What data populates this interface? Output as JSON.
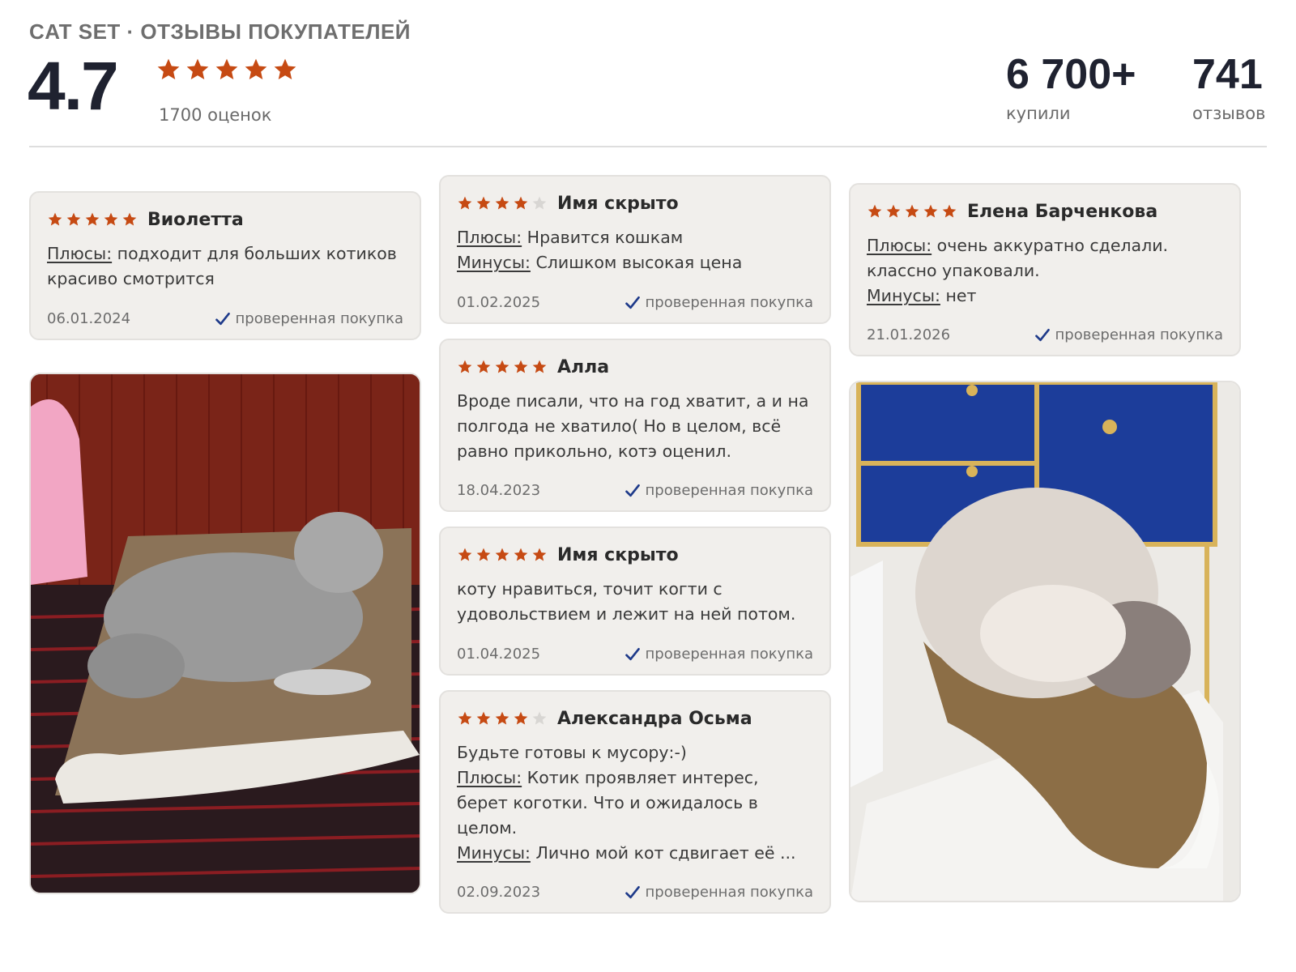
{
  "header": {
    "label": "CAT SET · ОТЗЫВЫ ПОКУПАТЕЛЕЙ",
    "rating": "4.7",
    "rating_stars": 5,
    "ratings_count": "1700 оценок",
    "bought_value": "6 700+",
    "bought_label": "купили",
    "reviews_value": "741",
    "reviews_label": "отзывов"
  },
  "colors": {
    "star_filled": "#c64a13",
    "star_empty": "#d8d6d3",
    "check": "#1e3a8a",
    "card_bg": "#f1efec"
  },
  "verified_label": "проверенная покупка",
  "reviews": [
    {
      "stars": 5,
      "author": "Виолетта",
      "lines": [
        {
          "key": "Плюсы:",
          "text": "подходит для больших котиков красиво смотрится"
        }
      ],
      "date": "06.01.2024"
    },
    {
      "stars": 4,
      "author": "Имя скрыто",
      "lines": [
        {
          "key": "Плюсы:",
          "text": "Нравится кошкам"
        },
        {
          "key": "Минусы:",
          "text": "Слишком высокая цена"
        }
      ],
      "date": "01.02.2025"
    },
    {
      "stars": 5,
      "author": "Алла",
      "lines": [
        {
          "key": "",
          "text": "Вроде писали, что на год хватит, а и на полгода не хватило( Но в целом, всё равно прикольно, котэ оценил."
        }
      ],
      "date": "18.04.2023"
    },
    {
      "stars": 5,
      "author": "Имя скрыто",
      "lines": [
        {
          "key": "",
          "text": "коту нравиться, точит когти с удовольствием и лежит на ней потом."
        }
      ],
      "date": "01.04.2025"
    },
    {
      "stars": 4,
      "author": "Александра Осьма",
      "lines": [
        {
          "key": "",
          "text": "Будьте готовы к мусору:-)"
        },
        {
          "key": "Плюсы:",
          "text": "Котик проявляет интерес, берет коготки. Что и ожидалось в целом."
        },
        {
          "key": "Минусы:",
          "text": "Лично мой кот сдвигает её ..."
        }
      ],
      "date": "02.09.2023"
    },
    {
      "stars": 5,
      "author": "Елена Барченкова",
      "lines": [
        {
          "key": "Плюсы:",
          "text": "очень аккуратно сделали. классно упаковали."
        },
        {
          "key": "Минусы:",
          "text": "нет"
        }
      ],
      "date": "21.01.2026"
    }
  ],
  "photos": [
    {
      "icon": "tabby-cat-on-scratcher-photo"
    },
    {
      "icon": "fluffy-cat-on-scratcher-photo"
    }
  ]
}
